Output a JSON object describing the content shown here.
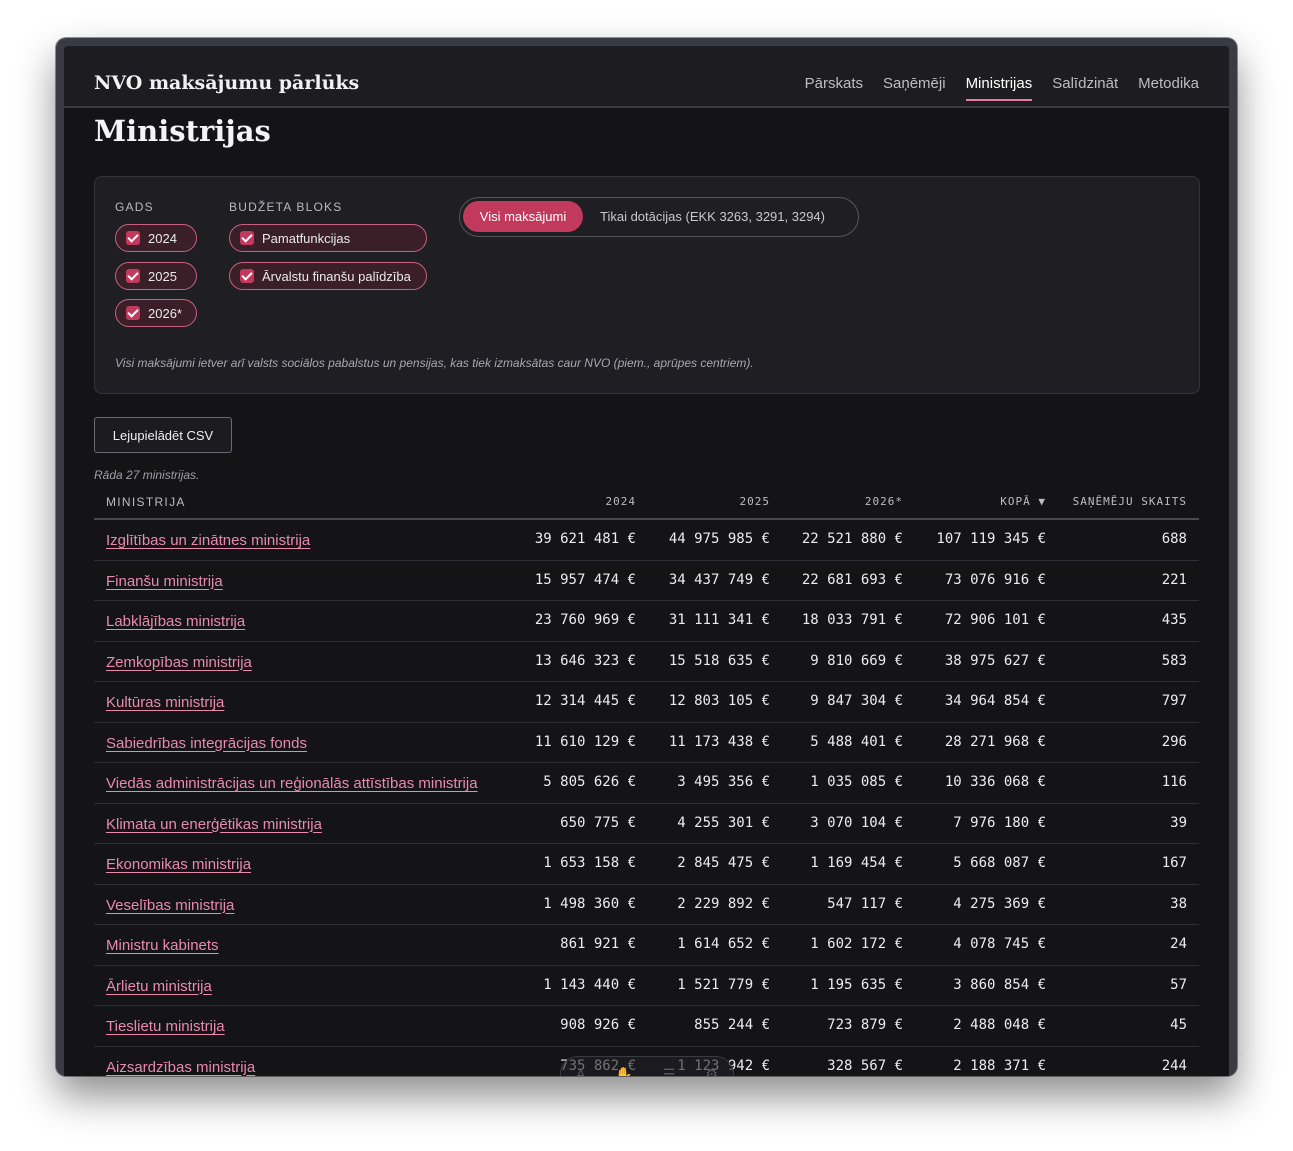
{
  "app": {
    "brand": "NVO maksājumu pārlūks"
  },
  "nav": [
    {
      "label": "Pārskats",
      "active": false
    },
    {
      "label": "Saņēmēji",
      "active": false
    },
    {
      "label": "Ministrijas",
      "active": true
    },
    {
      "label": "Salīdzināt",
      "active": false
    },
    {
      "label": "Metodika",
      "active": false
    }
  ],
  "page": {
    "title": "Ministrijas"
  },
  "filters": {
    "years_label": "GADS",
    "years": [
      "2024",
      "2025",
      "2026*"
    ],
    "budget_label": "BUDŽETA BLOKS",
    "budget": [
      "Pamatfunkcijas",
      "Ārvalstu finanšu palīdzība"
    ],
    "toggle_on": "Visi maksājumi",
    "toggle_off": "Tikai dotācijas (EKK 3263, 3291, 3294)",
    "note": "Visi maksājumi ietver arī valsts sociālos pabalstus un pensijas, kas tiek izmaksātas caur NVO (piem., aprūpes centriem)."
  },
  "actions": {
    "csv": "Lejupielādēt CSV"
  },
  "table": {
    "count_note": "Rāda 27 ministrijas.",
    "headers": [
      "MINISTRIJA",
      "2024",
      "2025",
      "2026*",
      "KOPĀ ▼",
      "SAŅĒMĒJU SKAITS"
    ],
    "rows": [
      [
        "Izglītības un zinātnes ministrija",
        "39 621 481 €",
        "44 975 985 €",
        "22 521 880 €",
        "107 119 345 €",
        "688"
      ],
      [
        "Finanšu ministrija",
        "15 957 474 €",
        "34 437 749 €",
        "22 681 693 €",
        "73 076 916 €",
        "221"
      ],
      [
        "Labklājības ministrija",
        "23 760 969 €",
        "31 111 341 €",
        "18 033 791 €",
        "72 906 101 €",
        "435"
      ],
      [
        "Zemkopības ministrija",
        "13 646 323 €",
        "15 518 635 €",
        "9 810 669 €",
        "38 975 627 €",
        "583"
      ],
      [
        "Kultūras ministrija",
        "12 314 445 €",
        "12 803 105 €",
        "9 847 304 €",
        "34 964 854 €",
        "797"
      ],
      [
        "Sabiedrības integrācijas fonds",
        "11 610 129 €",
        "11 173 438 €",
        "5 488 401 €",
        "28 271 968 €",
        "296"
      ],
      [
        "Viedās administrācijas un reģionālās attīstības ministrija",
        "5 805 626 €",
        "3 495 356 €",
        "1 035 085 €",
        "10 336 068 €",
        "116"
      ],
      [
        "Klimata un enerģētikas ministrija",
        "650 775 €",
        "4 255 301 €",
        "3 070 104 €",
        "7 976 180 €",
        "39"
      ],
      [
        "Ekonomikas ministrija",
        "1 653 158 €",
        "2 845 475 €",
        "1 169 454 €",
        "5 668 087 €",
        "167"
      ],
      [
        "Veselības ministrija",
        "1 498 360 €",
        "2 229 892 €",
        "547 117 €",
        "4 275 369 €",
        "38"
      ],
      [
        "Ministru kabinets",
        "861 921 €",
        "1 614 652 €",
        "1 602 172 €",
        "4 078 745 €",
        "24"
      ],
      [
        "Ārlietu ministrija",
        "1 143 440 €",
        "1 521 779 €",
        "1 195 635 €",
        "3 860 854 €",
        "57"
      ],
      [
        "Tieslietu ministrija",
        "908 926 €",
        "855 244 €",
        "723 879 €",
        "2 488 048 €",
        "45"
      ],
      [
        "Aizsardzības ministrija",
        "735 862 €",
        "1 123 942 €",
        "328 567 €",
        "2 188 371 €",
        "244"
      ]
    ]
  },
  "colors": {
    "accent": "#c13a5e",
    "link": "#e98aab",
    "background": "#141417"
  }
}
